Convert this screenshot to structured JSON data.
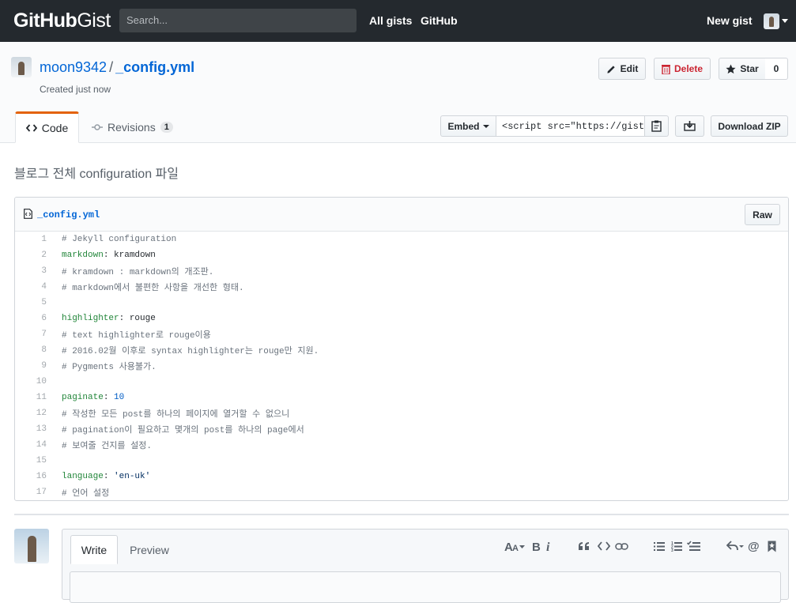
{
  "header": {
    "logo_bold": "GitHub",
    "logo_light": "Gist",
    "search_placeholder": "Search...",
    "nav": [
      "All gists",
      "GitHub"
    ],
    "new_gist": "New gist"
  },
  "gist": {
    "owner": "moon9342",
    "separator": "/",
    "filename": "_config.yml",
    "created": "Created just now",
    "actions": {
      "edit": "Edit",
      "delete": "Delete",
      "star": "Star",
      "star_count": "0"
    },
    "tabs": {
      "code": "Code",
      "revisions": "Revisions",
      "revisions_count": "1"
    },
    "embed": {
      "label": "Embed",
      "value": "<script src=\"https://gist."
    },
    "download": "Download ZIP",
    "description": "블로그 전체 configuration 파일"
  },
  "file": {
    "name": "_config.yml",
    "raw": "Raw",
    "lines": [
      {
        "n": "1",
        "type": "comment",
        "text": "# Jekyll configuration"
      },
      {
        "n": "2",
        "type": "kv",
        "key": "markdown",
        "value": "kramdown",
        "vtype": "plain"
      },
      {
        "n": "3",
        "type": "comment",
        "text": "# kramdown : markdown의 개조판."
      },
      {
        "n": "4",
        "type": "comment",
        "text": "# markdown에서 불편한 사항을 개선한 형태."
      },
      {
        "n": "5",
        "type": "blank",
        "text": ""
      },
      {
        "n": "6",
        "type": "kv",
        "key": "highlighter",
        "value": "rouge",
        "vtype": "plain"
      },
      {
        "n": "7",
        "type": "comment",
        "text": "# text highlighter로 rouge이용"
      },
      {
        "n": "8",
        "type": "comment",
        "text": "# 2016.02월 이후로 syntax highlighter는 rouge만 지원."
      },
      {
        "n": "9",
        "type": "comment",
        "text": "# Pygments 사용불가."
      },
      {
        "n": "10",
        "type": "blank",
        "text": ""
      },
      {
        "n": "11",
        "type": "kv",
        "key": "paginate",
        "value": "10",
        "vtype": "num"
      },
      {
        "n": "12",
        "type": "comment",
        "text": "# 작성한 모든 post를 하나의 페이지에 열거할 수 없으니"
      },
      {
        "n": "13",
        "type": "comment",
        "text": "# pagination이 필요하고 몇개의 post를 하나의 page에서"
      },
      {
        "n": "14",
        "type": "comment",
        "text": "# 보여줄 건지를 설정."
      },
      {
        "n": "15",
        "type": "blank",
        "text": ""
      },
      {
        "n": "16",
        "type": "kv",
        "key": "language",
        "value": "'en-uk'",
        "vtype": "str"
      },
      {
        "n": "17",
        "type": "comment",
        "text": "# 언어 설정"
      }
    ]
  },
  "comment": {
    "write_tab": "Write",
    "preview_tab": "Preview",
    "toolbar": [
      "text-size-icon",
      "bold-icon",
      "italic-icon",
      "quote-icon",
      "code-icon",
      "link-icon",
      "unordered-list-icon",
      "ordered-list-icon",
      "task-list-icon",
      "reply-icon",
      "mention-icon",
      "bookmark-icon"
    ]
  },
  "colors": {
    "header_bg": "#24292e",
    "link": "#0366d6",
    "delete": "#cb2431",
    "tab_accent": "#e36209"
  }
}
